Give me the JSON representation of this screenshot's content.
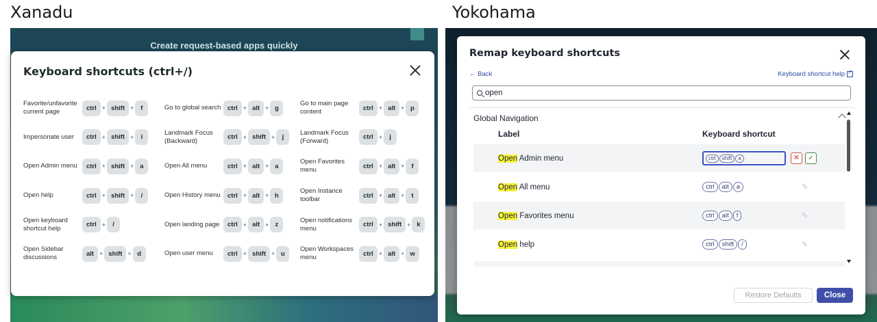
{
  "left": {
    "heading": "Xanadu",
    "background_banner": "Create request-based apps quickly",
    "modal_title": "Keyboard shortcuts (ctrl+/)",
    "shortcuts": [
      {
        "label": "Favorite/unfavorite current page",
        "keys": [
          "ctrl",
          "shift",
          "f"
        ]
      },
      {
        "label": "Go to global search",
        "keys": [
          "ctrl",
          "alt",
          "g"
        ]
      },
      {
        "label": "Go to main page content",
        "keys": [
          "ctrl",
          "alt",
          "p"
        ]
      },
      {
        "label": "Impersonate user",
        "keys": [
          "ctrl",
          "shift",
          "i"
        ]
      },
      {
        "label": "Landmark Focus (Backward)",
        "keys": [
          "ctrl",
          "shift",
          "j"
        ]
      },
      {
        "label": "Landmark Focus (Forward)",
        "keys": [
          "ctrl",
          "j"
        ]
      },
      {
        "label": "Open Admin menu",
        "keys": [
          "ctrl",
          "shift",
          "a"
        ]
      },
      {
        "label": "Open All menu",
        "keys": [
          "ctrl",
          "alt",
          "a"
        ]
      },
      {
        "label": "Open Favorites menu",
        "keys": [
          "ctrl",
          "alt",
          "f"
        ]
      },
      {
        "label": "Open help",
        "keys": [
          "ctrl",
          "shift",
          "/"
        ]
      },
      {
        "label": "Open History menu",
        "keys": [
          "ctrl",
          "alt",
          "h"
        ]
      },
      {
        "label": "Open Instance toolbar",
        "keys": [
          "ctrl",
          "alt",
          "t"
        ]
      },
      {
        "label": "Open keyboard shortcut help",
        "keys": [
          "ctrl",
          "/"
        ]
      },
      {
        "label": "Open landing page",
        "keys": [
          "ctrl",
          "alt",
          "z"
        ]
      },
      {
        "label": "Open notifications menu",
        "keys": [
          "ctrl",
          "shift",
          "k"
        ]
      },
      {
        "label": "Open Sidebar discussions",
        "keys": [
          "alt",
          "shift",
          "d"
        ]
      },
      {
        "label": "Open user menu",
        "keys": [
          "ctrl",
          "shift",
          "u"
        ]
      },
      {
        "label": "Open Workspaces menu",
        "keys": [
          "ctrl",
          "alt",
          "w"
        ]
      }
    ]
  },
  "right": {
    "heading": "Yokohama",
    "modal_title": "Remap keyboard shortcuts",
    "back_label": "← Back",
    "help_link": "Keyboard shortcut help",
    "search_value": "open",
    "section_title": "Global Navigation",
    "col_label": "Label",
    "col_shortcut": "Keyboard shortcut",
    "rows": [
      {
        "match": "Open",
        "rest": " Admin menu",
        "keys": [
          "ctrl",
          "shift",
          "a"
        ],
        "editing": true
      },
      {
        "match": "Open",
        "rest": " All menu",
        "keys": [
          "ctrl",
          "alt",
          "a"
        ],
        "editing": false
      },
      {
        "match": "Open",
        "rest": " Favorites menu",
        "keys": [
          "ctrl",
          "alt",
          "f"
        ],
        "editing": false
      },
      {
        "match": "Open",
        "rest": " help",
        "keys": [
          "ctrl",
          "shift",
          "/"
        ],
        "editing": false
      }
    ],
    "restore_label": "Restore Defaults",
    "close_label": "Close",
    "colors": {
      "accent": "#3f4fa8",
      "highlight": "#f6f23a",
      "focus_border": "#3a53c5"
    }
  }
}
